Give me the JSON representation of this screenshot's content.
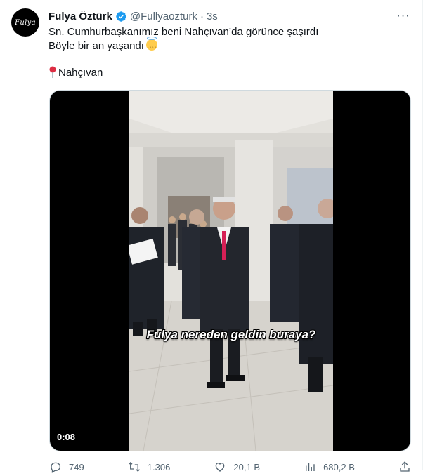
{
  "tweet": {
    "author_name": "Fulya Öztürk",
    "handle": "@Fullyaozturk",
    "separator": "·",
    "time": "3s",
    "avatar_text": "Fulya",
    "more_label": "···",
    "text_line1": "Sn. Cumhurbaşkanımız beni Nahçıvan’da görünce şaşırdı",
    "text_line2": "Böyle bir an yaşandı",
    "location": "Nahçıvan",
    "video": {
      "caption": "Fulya nereden geldin buraya?",
      "duration": "0:08"
    },
    "actions": {
      "replies": "749",
      "retweets": "1.306",
      "likes": "20,1 B",
      "views": "680,2 B"
    }
  },
  "colors": {
    "verified": "#1d9bf0",
    "secondary_text": "#536471",
    "media_bg": "#000000"
  }
}
